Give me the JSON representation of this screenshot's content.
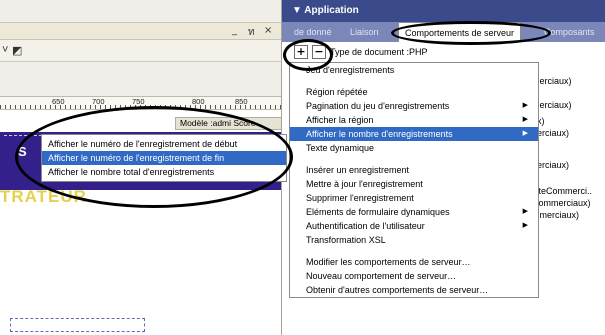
{
  "doc_window": {
    "minimize_label": "_",
    "restore_label": "ท",
    "close_label": "×",
    "toolbar_dropdown": "˅",
    "toolbar_icon": "◩",
    "ruler_labels": [
      "650",
      "700",
      "750",
      "800",
      "850"
    ],
    "model_label": "Modèle :admi  Score",
    "banner_letter": "S",
    "banner_text": "TRATEUR"
  },
  "submenu": {
    "items": [
      {
        "label": "Afficher le numéro de l'enregistrement de début"
      },
      {
        "label": "Afficher le numéro de l'enregistrement de fin"
      },
      {
        "label": "Afficher le nombre total d'enregistrements"
      }
    ]
  },
  "panel": {
    "title": "▼ Application",
    "tabs": [
      "de donné",
      "Liaison",
      "Comportements de serveur",
      "Composants"
    ],
    "add_button": "+",
    "remove_button": "−",
    "doc_type": "Type de document :PHP"
  },
  "bindings": [
    "merciaux)",
    "merciaux)",
    "ux)",
    "nerciaux)",
    "nerciaux)",
    "isteCommerci..",
    "Commerciaux)",
    "mmerciaux)"
  ],
  "mainmenu": {
    "items": [
      {
        "label": "Jeu d'enregistrements"
      },
      {
        "label": "Région répétée"
      },
      {
        "label": "Pagination du jeu d'enregistrements"
      },
      {
        "label": "Afficher la région"
      },
      {
        "label": "Afficher le nombre d'enregistrements"
      },
      {
        "label": "Texte dynamique"
      },
      {
        "label": "Insérer un enregistrement"
      },
      {
        "label": "Mettre à jour l'enregistrement"
      },
      {
        "label": "Supprimer l'enregistrement"
      },
      {
        "label": "Eléments de formulaire dynamiques"
      },
      {
        "label": "Authentification de l'utilisateur"
      },
      {
        "label": "Transformation XSL"
      },
      {
        "label": "Modifier les comportements de serveur…"
      },
      {
        "label": "Nouveau comportement de serveur…"
      },
      {
        "label": "Obtenir d'autres comportements de serveur…"
      }
    ]
  }
}
